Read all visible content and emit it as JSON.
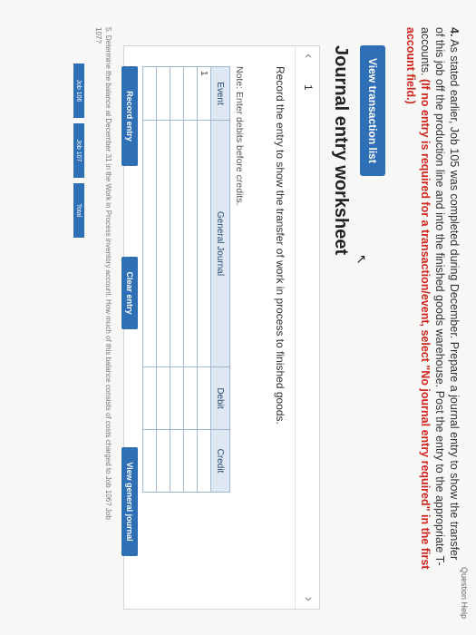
{
  "header": {
    "top_right": "Question Help"
  },
  "question": {
    "number": "4.",
    "text": "As stated earlier, Job 105 was completed during December. Prepare a journal entry to show the transfer of this job off the production line and into the finished goods warehouse. Post the entry to the appropriate T-accounts.",
    "required_note": "(If no entry is required for a transaction/event, select \"No journal entry required\" in the first account field.)"
  },
  "buttons": {
    "view_transaction_list": "View transaction list"
  },
  "worksheet": {
    "title": "Journal entry worksheet",
    "page_number": "1",
    "instruction": "Record the entry to show the transfer of work in process to finished goods.",
    "note_label": "Note:",
    "note_text": "Enter debits before credits.",
    "table": {
      "headers": [
        "Event",
        "General Journal",
        "Debit",
        "Credit"
      ],
      "rows": [
        [
          "1",
          "",
          "",
          ""
        ],
        [
          "",
          "",
          "",
          ""
        ],
        [
          "",
          "",
          "",
          ""
        ],
        [
          "",
          "",
          "",
          ""
        ],
        [
          "",
          "",
          "",
          ""
        ]
      ]
    },
    "actions": {
      "record_entry": "Record entry",
      "clear_entry": "Clear entry",
      "view_general_journal": "View general journal"
    }
  },
  "question5": {
    "text": "5. Determine the balance at December 31 in the Work in Process inventory account. How much of this balance consists of costs charged to Job 106? Job 107?",
    "tabs": [
      "Job 106",
      "Job 107",
      "Total"
    ]
  }
}
